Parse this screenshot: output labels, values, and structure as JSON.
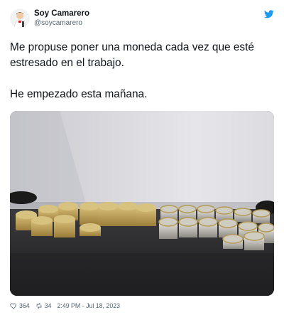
{
  "tweet": {
    "author_name": "Soy Camarero",
    "author_handle": "@soycamarero",
    "text_lines": [
      "Me propuse poner una moneda cada vez que esté estresado en el trabajo.",
      "He empezado esta mañana."
    ],
    "likes": "364",
    "retweets": "34",
    "timestamp": "2:49 PM - Jul 18, 2023"
  },
  "icons": {
    "platform": "twitter-bird-icon",
    "like": "heart-icon",
    "retweet": "retweet-icon"
  },
  "colors": {
    "brand": "#1d9bf0",
    "text": "#0f1419",
    "muted": "#536471"
  }
}
